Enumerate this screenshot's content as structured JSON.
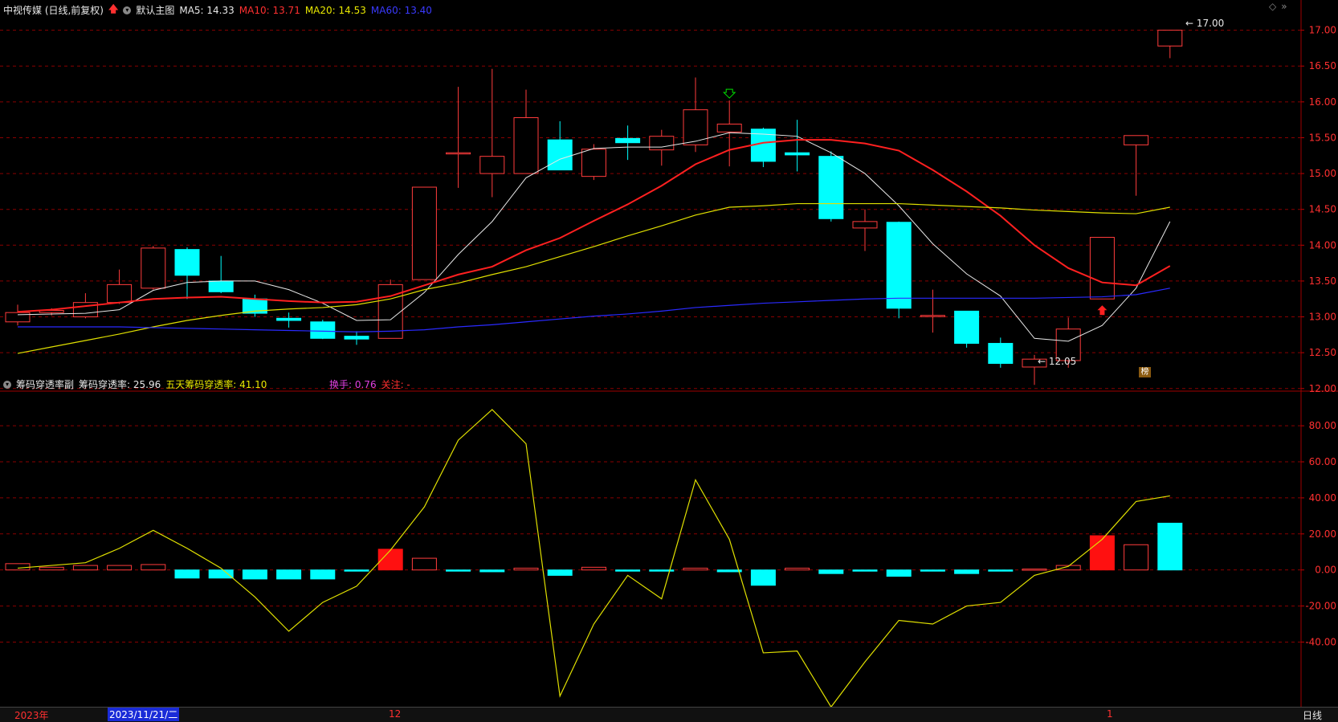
{
  "header": {
    "stock_title": "中视传媒 (日线,前复权)",
    "template": "默认主图",
    "ma5": "MA5: 14.33",
    "ma10": "MA10: 13.71",
    "ma20": "MA20: 14.53",
    "ma60": "MA60: 13.40",
    "colors": {
      "ma5": "#e8e8e8",
      "ma10": "#ff2a2a",
      "ma20": "#e8e800",
      "ma60": "#2a2aff"
    }
  },
  "sub_header": {
    "indicator": "筹码穿透率副",
    "value_label": "筹码穿透率: 25.96",
    "five_day": "五天筹码穿透率: 41.10",
    "turnover": "换手: 0.76",
    "follow": "关注: -"
  },
  "annotations": {
    "high_label": "17.00",
    "low_label": "12.05",
    "badge": "榜"
  },
  "footer": {
    "year": "2023年",
    "date_box": "2023/11/21/二",
    "month_12": "12",
    "month_1": "1",
    "period": "日线"
  },
  "icons": [
    "arrow-up-icon",
    "chevron-down-icon",
    "diamond-icon",
    "double-arrow-icon"
  ],
  "chart_data": [
    {
      "type": "candlestick",
      "yticks": [
        "17.00",
        "16.50",
        "16.00",
        "15.50",
        "15.00",
        "14.50",
        "14.00",
        "13.50",
        "13.00",
        "12.50",
        "12.00"
      ],
      "ylim": [
        11.93,
        17.22
      ],
      "candles": [
        {
          "o": 12.93,
          "c": 13.06,
          "h": 13.17,
          "l": 12.88
        },
        {
          "o": 13.06,
          "c": 13.09,
          "h": 13.12,
          "l": 13.02
        },
        {
          "o": 13.0,
          "c": 13.2,
          "h": 13.33,
          "l": 12.98
        },
        {
          "o": 13.2,
          "c": 13.45,
          "h": 13.66,
          "l": 13.18
        },
        {
          "o": 13.4,
          "c": 13.96,
          "h": 13.99,
          "l": 13.38
        },
        {
          "o": 13.94,
          "c": 13.58,
          "h": 13.97,
          "l": 13.25
        },
        {
          "o": 13.5,
          "c": 13.35,
          "h": 13.85,
          "l": 13.33
        },
        {
          "o": 13.25,
          "c": 13.05,
          "h": 13.31,
          "l": 13.0
        },
        {
          "o": 12.98,
          "c": 12.95,
          "h": 13.06,
          "l": 12.85
        },
        {
          "o": 12.93,
          "c": 12.7,
          "h": 12.96,
          "l": 12.69
        },
        {
          "o": 12.73,
          "c": 12.69,
          "h": 12.8,
          "l": 12.61
        },
        {
          "o": 12.7,
          "c": 13.45,
          "h": 13.52,
          "l": 12.7
        },
        {
          "o": 13.52,
          "c": 14.81,
          "h": 14.81,
          "l": 13.52
        },
        {
          "o": 15.29,
          "c": 15.29,
          "h": 16.21,
          "l": 14.8
        },
        {
          "o": 15.0,
          "c": 15.24,
          "h": 16.46,
          "l": 14.67
        },
        {
          "o": 15.0,
          "c": 15.78,
          "h": 16.17,
          "l": 15.0
        },
        {
          "o": 15.47,
          "c": 15.05,
          "h": 15.73,
          "l": 15.05
        },
        {
          "o": 14.96,
          "c": 15.34,
          "h": 15.41,
          "l": 14.91
        },
        {
          "o": 15.49,
          "c": 15.43,
          "h": 15.67,
          "l": 15.19
        },
        {
          "o": 15.33,
          "c": 15.52,
          "h": 15.61,
          "l": 15.11
        },
        {
          "o": 15.4,
          "c": 15.89,
          "h": 16.34,
          "l": 15.3
        },
        {
          "o": 15.58,
          "c": 15.69,
          "h": 16.02,
          "l": 15.1
        },
        {
          "o": 15.62,
          "c": 15.17,
          "h": 15.64,
          "l": 15.09
        },
        {
          "o": 15.29,
          "c": 15.26,
          "h": 15.75,
          "l": 15.03
        },
        {
          "o": 15.24,
          "c": 14.37,
          "h": 15.31,
          "l": 14.33
        },
        {
          "o": 14.24,
          "c": 14.33,
          "h": 14.5,
          "l": 13.92
        },
        {
          "o": 14.32,
          "c": 13.12,
          "h": 14.33,
          "l": 12.98
        },
        {
          "o": 13.02,
          "c": 13.02,
          "h": 13.38,
          "l": 12.78
        },
        {
          "o": 13.08,
          "c": 12.63,
          "h": 13.08,
          "l": 12.57
        },
        {
          "o": 12.63,
          "c": 12.35,
          "h": 12.71,
          "l": 12.29
        },
        {
          "o": 12.3,
          "c": 12.41,
          "h": 12.47,
          "l": 12.05
        },
        {
          "o": 12.39,
          "c": 12.83,
          "h": 12.99,
          "l": 12.29
        },
        {
          "o": 13.25,
          "c": 14.11,
          "h": 14.11,
          "l": 13.25
        },
        {
          "o": 15.4,
          "c": 15.53,
          "h": 15.53,
          "l": 14.69
        },
        {
          "o": 16.78,
          "c": 17.0,
          "h": 17.0,
          "l": 16.61
        }
      ],
      "series": [
        {
          "name": "MA5",
          "values": [
            13.03,
            13.04,
            13.05,
            13.1,
            13.37,
            13.48,
            13.5,
            13.5,
            13.38,
            13.19,
            12.95,
            12.96,
            13.34,
            13.87,
            14.33,
            14.94,
            15.2,
            15.35,
            15.37,
            15.37,
            15.45,
            15.57,
            15.55,
            15.52,
            15.29,
            15.0,
            14.55,
            14.02,
            13.6,
            13.29,
            12.7,
            12.66,
            12.88,
            13.4,
            14.33
          ]
        },
        {
          "name": "MA10",
          "values": [
            13.07,
            13.1,
            13.15,
            13.2,
            13.25,
            13.27,
            13.28,
            13.25,
            13.22,
            13.2,
            13.21,
            13.29,
            13.44,
            13.59,
            13.7,
            13.93,
            14.1,
            14.34,
            14.57,
            14.83,
            15.13,
            15.33,
            15.43,
            15.47,
            15.47,
            15.42,
            15.32,
            15.05,
            14.75,
            14.41,
            14.0,
            13.68,
            13.48,
            13.44,
            13.71
          ]
        },
        {
          "name": "MA20",
          "values": [
            12.49,
            12.58,
            12.67,
            12.76,
            12.86,
            12.95,
            13.02,
            13.08,
            13.11,
            13.13,
            13.17,
            13.25,
            13.38,
            13.47,
            13.59,
            13.7,
            13.84,
            13.98,
            14.13,
            14.27,
            14.42,
            14.53,
            14.55,
            14.58,
            14.58,
            14.58,
            14.58,
            14.56,
            14.54,
            14.52,
            14.49,
            14.47,
            14.45,
            14.44,
            14.53
          ]
        },
        {
          "name": "MA60",
          "values": [
            12.86,
            12.86,
            12.86,
            12.86,
            12.85,
            12.84,
            12.83,
            12.82,
            12.81,
            12.8,
            12.79,
            12.8,
            12.82,
            12.86,
            12.89,
            12.93,
            12.97,
            13.01,
            13.04,
            13.08,
            13.13,
            13.16,
            13.19,
            13.21,
            13.23,
            13.25,
            13.26,
            13.26,
            13.26,
            13.26,
            13.26,
            13.27,
            13.28,
            13.31,
            13.4
          ]
        }
      ],
      "markers": [
        {
          "index": 21,
          "type": "down-arrow",
          "color": "#00e000"
        },
        {
          "index": 32,
          "type": "up-arrow",
          "color": "#ff2020"
        }
      ]
    },
    {
      "type": "bar",
      "yticks": [
        "80.00",
        "60.00",
        "40.00",
        "20.00",
        "0.00",
        "-20.00",
        "-40.00"
      ],
      "ylim": [
        -75,
        97
      ],
      "values": [
        3.5,
        1.5,
        2.5,
        2.5,
        3.0,
        -4.5,
        -4.5,
        -5.0,
        -5.0,
        -5.0,
        -0.5,
        11.5,
        6.5,
        -0.5,
        -1.0,
        1.0,
        -3.0,
        1.5,
        -0.5,
        -0.5,
        1.0,
        -1.0,
        -8.5,
        1.0,
        -2.0,
        -0.5,
        -3.5,
        -0.5,
        -2.0,
        -0.5,
        0.5,
        2.5,
        19.0,
        14.0,
        25.96
      ],
      "series": [
        {
          "name": "五天筹码穿透率",
          "values": [
            1.0,
            2.5,
            4.0,
            12.0,
            22.0,
            12.0,
            1.0,
            -15.0,
            -34.0,
            -18.0,
            -9.0,
            11.0,
            35.0,
            72.0,
            89.0,
            70.0,
            -70.0,
            -30.0,
            -3.0,
            -16.0,
            50.0,
            17.0,
            -46.0,
            -45.0,
            -76.0,
            -51.0,
            -28.0,
            -30.0,
            -20.0,
            -18.0,
            -3.0,
            2.0,
            17.0,
            38.0,
            41.1
          ]
        }
      ]
    }
  ]
}
